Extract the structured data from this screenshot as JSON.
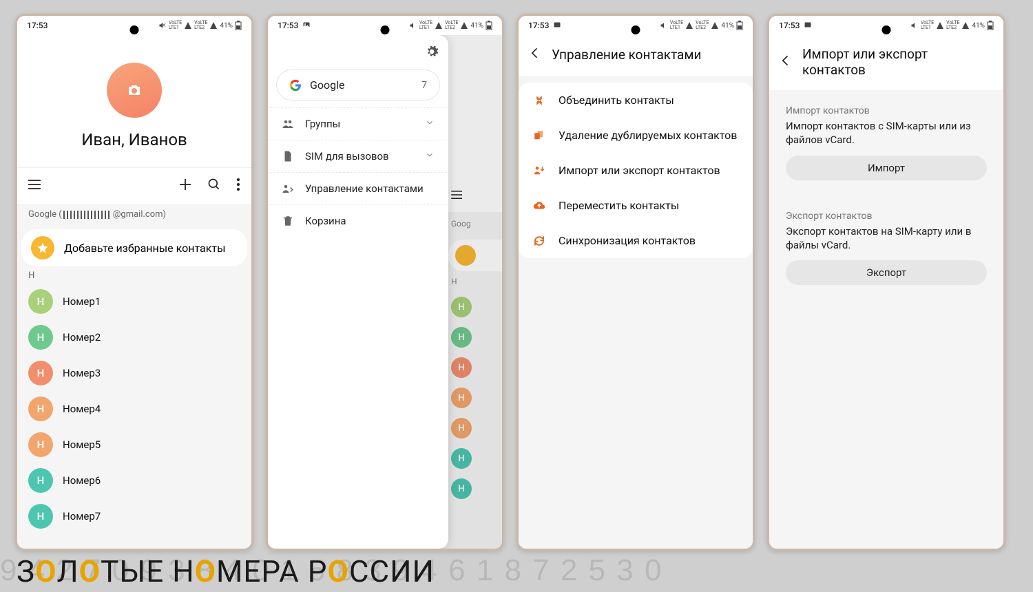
{
  "status": {
    "time": "17:53",
    "battery": "41%",
    "signal_label": "LTE",
    "icons": [
      "mute-icon",
      "volte-icon",
      "signal-icon",
      "battery-icon"
    ]
  },
  "screen1": {
    "profile_name": "Иван, Иванов",
    "account_prefix": "Google (",
    "account_suffix": "@gmail.com)",
    "favorites_label": "Добавьте избранные контакты",
    "section_letter": "Н",
    "contacts": [
      {
        "letter": "Н",
        "name": "Номер1",
        "color": "#a9d07a"
      },
      {
        "letter": "Н",
        "name": "Номер2",
        "color": "#6fc98f"
      },
      {
        "letter": "Н",
        "name": "Номер3",
        "color": "#f08e6e"
      },
      {
        "letter": "Н",
        "name": "Номер4",
        "color": "#f3a56e"
      },
      {
        "letter": "Н",
        "name": "Номер5",
        "color": "#f3a56e"
      },
      {
        "letter": "Н",
        "name": "Номер6",
        "color": "#4dc6b0"
      },
      {
        "letter": "Н",
        "name": "Номер7",
        "color": "#4dc6b0"
      }
    ]
  },
  "screen2": {
    "account_name": "Google",
    "account_count": "7",
    "items": [
      {
        "icon": "people-icon",
        "label": "Группы",
        "expandable": true
      },
      {
        "icon": "sim-icon",
        "label": "SIM для вызовов",
        "expandable": true
      },
      {
        "icon": "manage-icon",
        "label": "Управление контактами",
        "expandable": false
      },
      {
        "icon": "trash-icon",
        "label": "Корзина",
        "expandable": false
      }
    ]
  },
  "screen3": {
    "title": "Управление контактами",
    "items": [
      {
        "icon": "merge-icon",
        "label": "Объединить контакты"
      },
      {
        "icon": "dedup-icon",
        "label": "Удаление дублируемых контактов"
      },
      {
        "icon": "import-export-icon",
        "label": "Импорт или экспорт контактов"
      },
      {
        "icon": "cloud-move-icon",
        "label": "Переместить контакты"
      },
      {
        "icon": "sync-icon",
        "label": "Синхронизация контактов"
      }
    ]
  },
  "screen4": {
    "title": "Импорт или экспорт контактов",
    "import": {
      "heading": "Импорт контактов",
      "desc": "Импорт контактов с SIM-карты или из файлов vCard.",
      "button": "Импорт"
    },
    "export": {
      "heading": "Экспорт контактов",
      "desc": "Экспорт контактов на SIM-карту или в файлы vCard.",
      "button": "Экспорт"
    }
  },
  "banner": {
    "text_parts": [
      "З",
      "О",
      "Л",
      "О",
      "ТЫЕ Н",
      "О",
      "МЕРА Р",
      "О",
      "ССИИ"
    ],
    "accent_indices": [
      1,
      3,
      5,
      7
    ],
    "bg_digits": "9 4 2 7 0 9 3 8 4 0 1 5 8 3 9 4 6 1 8 7 2 5 3 0"
  }
}
